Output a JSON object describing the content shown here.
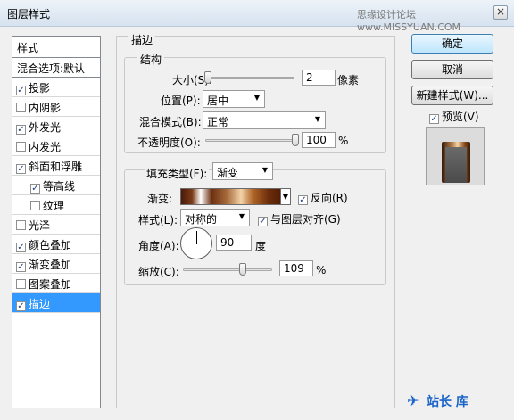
{
  "window": {
    "title": "图层样式",
    "watermark_top": "思缘设计论坛 www.MISSYUAN.COM",
    "watermark_bottom": "站长 库",
    "close_glyph": "×"
  },
  "sidebar": {
    "header": "样式",
    "blend_default": "混合选项:默认",
    "items": [
      {
        "label": "投影",
        "checked": true,
        "check": "✓"
      },
      {
        "label": "内阴影",
        "checked": false,
        "check": ""
      },
      {
        "label": "外发光",
        "checked": true,
        "check": "✓"
      },
      {
        "label": "内发光",
        "checked": false,
        "check": ""
      },
      {
        "label": "斜面和浮雕",
        "checked": true,
        "check": "✓"
      },
      {
        "label": "等高线",
        "checked": true,
        "check": "✓"
      },
      {
        "label": "纹理",
        "checked": false,
        "check": ""
      },
      {
        "label": "光泽",
        "checked": false,
        "check": ""
      },
      {
        "label": "颜色叠加",
        "checked": true,
        "check": "✓"
      },
      {
        "label": "渐变叠加",
        "checked": true,
        "check": "✓"
      },
      {
        "label": "图案叠加",
        "checked": false,
        "check": ""
      },
      {
        "label": "描边",
        "checked": true,
        "check": "✓"
      }
    ]
  },
  "stroke": {
    "section_title": "描边",
    "structure_title": "结构",
    "size_label": "大小(S):",
    "size_value": "2",
    "size_unit": "像素",
    "position_label": "位置(P):",
    "position_value": "居中",
    "blend_label": "混合模式(B):",
    "blend_value": "正常",
    "opacity_label": "不透明度(O):",
    "opacity_value": "100",
    "opacity_unit": "%",
    "fill_type_label": "填充类型(F):",
    "fill_type_value": "渐变",
    "gradient_label": "渐变:",
    "reverse_label": "反向(R)",
    "reverse_check": "✓",
    "style_label": "样式(L):",
    "style_value": "对称的",
    "align_label": "与图层对齐(G)",
    "align_check": "✓",
    "angle_label": "角度(A):",
    "angle_value": "90",
    "angle_unit": "度",
    "scale_label": "缩放(C):",
    "scale_value": "109",
    "scale_unit": "%",
    "size_slider_level": 0.0,
    "opacity_slider_level": 1.0,
    "scale_slider_level": 0.55
  },
  "buttons": {
    "ok": "确定",
    "cancel": "取消",
    "new_style": "新建样式(W)...",
    "preview_label": "预览(V)",
    "preview_check": "✓"
  }
}
